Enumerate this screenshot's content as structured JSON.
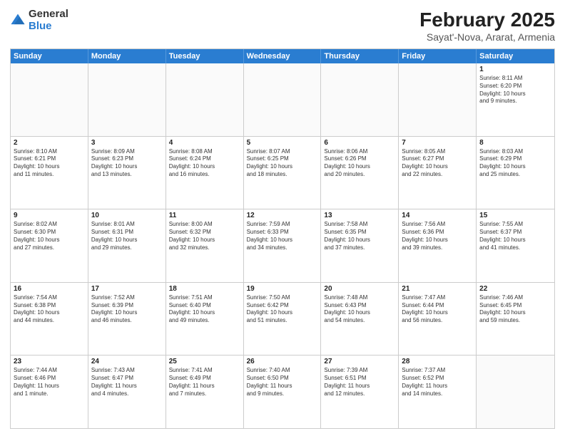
{
  "logo": {
    "general": "General",
    "blue": "Blue"
  },
  "title": {
    "month": "February 2025",
    "location": "Sayat'-Nova, Ararat, Armenia"
  },
  "header_days": [
    "Sunday",
    "Monday",
    "Tuesday",
    "Wednesday",
    "Thursday",
    "Friday",
    "Saturday"
  ],
  "weeks": [
    [
      {
        "day": "",
        "info": ""
      },
      {
        "day": "",
        "info": ""
      },
      {
        "day": "",
        "info": ""
      },
      {
        "day": "",
        "info": ""
      },
      {
        "day": "",
        "info": ""
      },
      {
        "day": "",
        "info": ""
      },
      {
        "day": "1",
        "info": "Sunrise: 8:11 AM\nSunset: 6:20 PM\nDaylight: 10 hours\nand 9 minutes."
      }
    ],
    [
      {
        "day": "2",
        "info": "Sunrise: 8:10 AM\nSunset: 6:21 PM\nDaylight: 10 hours\nand 11 minutes."
      },
      {
        "day": "3",
        "info": "Sunrise: 8:09 AM\nSunset: 6:23 PM\nDaylight: 10 hours\nand 13 minutes."
      },
      {
        "day": "4",
        "info": "Sunrise: 8:08 AM\nSunset: 6:24 PM\nDaylight: 10 hours\nand 16 minutes."
      },
      {
        "day": "5",
        "info": "Sunrise: 8:07 AM\nSunset: 6:25 PM\nDaylight: 10 hours\nand 18 minutes."
      },
      {
        "day": "6",
        "info": "Sunrise: 8:06 AM\nSunset: 6:26 PM\nDaylight: 10 hours\nand 20 minutes."
      },
      {
        "day": "7",
        "info": "Sunrise: 8:05 AM\nSunset: 6:27 PM\nDaylight: 10 hours\nand 22 minutes."
      },
      {
        "day": "8",
        "info": "Sunrise: 8:03 AM\nSunset: 6:29 PM\nDaylight: 10 hours\nand 25 minutes."
      }
    ],
    [
      {
        "day": "9",
        "info": "Sunrise: 8:02 AM\nSunset: 6:30 PM\nDaylight: 10 hours\nand 27 minutes."
      },
      {
        "day": "10",
        "info": "Sunrise: 8:01 AM\nSunset: 6:31 PM\nDaylight: 10 hours\nand 29 minutes."
      },
      {
        "day": "11",
        "info": "Sunrise: 8:00 AM\nSunset: 6:32 PM\nDaylight: 10 hours\nand 32 minutes."
      },
      {
        "day": "12",
        "info": "Sunrise: 7:59 AM\nSunset: 6:33 PM\nDaylight: 10 hours\nand 34 minutes."
      },
      {
        "day": "13",
        "info": "Sunrise: 7:58 AM\nSunset: 6:35 PM\nDaylight: 10 hours\nand 37 minutes."
      },
      {
        "day": "14",
        "info": "Sunrise: 7:56 AM\nSunset: 6:36 PM\nDaylight: 10 hours\nand 39 minutes."
      },
      {
        "day": "15",
        "info": "Sunrise: 7:55 AM\nSunset: 6:37 PM\nDaylight: 10 hours\nand 41 minutes."
      }
    ],
    [
      {
        "day": "16",
        "info": "Sunrise: 7:54 AM\nSunset: 6:38 PM\nDaylight: 10 hours\nand 44 minutes."
      },
      {
        "day": "17",
        "info": "Sunrise: 7:52 AM\nSunset: 6:39 PM\nDaylight: 10 hours\nand 46 minutes."
      },
      {
        "day": "18",
        "info": "Sunrise: 7:51 AM\nSunset: 6:40 PM\nDaylight: 10 hours\nand 49 minutes."
      },
      {
        "day": "19",
        "info": "Sunrise: 7:50 AM\nSunset: 6:42 PM\nDaylight: 10 hours\nand 51 minutes."
      },
      {
        "day": "20",
        "info": "Sunrise: 7:48 AM\nSunset: 6:43 PM\nDaylight: 10 hours\nand 54 minutes."
      },
      {
        "day": "21",
        "info": "Sunrise: 7:47 AM\nSunset: 6:44 PM\nDaylight: 10 hours\nand 56 minutes."
      },
      {
        "day": "22",
        "info": "Sunrise: 7:46 AM\nSunset: 6:45 PM\nDaylight: 10 hours\nand 59 minutes."
      }
    ],
    [
      {
        "day": "23",
        "info": "Sunrise: 7:44 AM\nSunset: 6:46 PM\nDaylight: 11 hours\nand 1 minute."
      },
      {
        "day": "24",
        "info": "Sunrise: 7:43 AM\nSunset: 6:47 PM\nDaylight: 11 hours\nand 4 minutes."
      },
      {
        "day": "25",
        "info": "Sunrise: 7:41 AM\nSunset: 6:49 PM\nDaylight: 11 hours\nand 7 minutes."
      },
      {
        "day": "26",
        "info": "Sunrise: 7:40 AM\nSunset: 6:50 PM\nDaylight: 11 hours\nand 9 minutes."
      },
      {
        "day": "27",
        "info": "Sunrise: 7:39 AM\nSunset: 6:51 PM\nDaylight: 11 hours\nand 12 minutes."
      },
      {
        "day": "28",
        "info": "Sunrise: 7:37 AM\nSunset: 6:52 PM\nDaylight: 11 hours\nand 14 minutes."
      },
      {
        "day": "",
        "info": ""
      }
    ]
  ]
}
